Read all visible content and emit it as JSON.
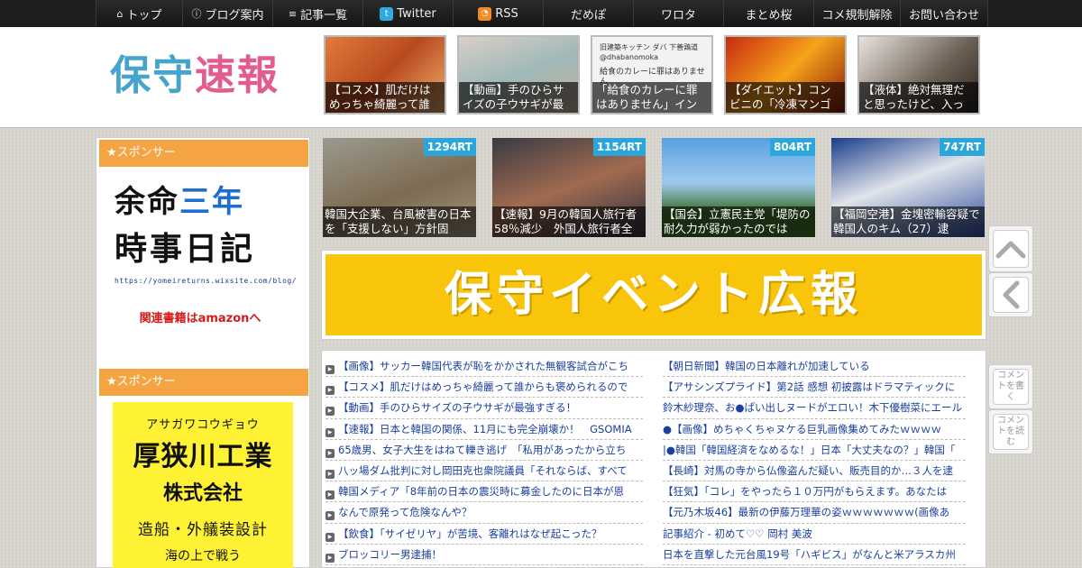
{
  "nav": {
    "items": [
      {
        "icon": "home-icon",
        "glyph": "⌂",
        "label": "トップ",
        "width": 96
      },
      {
        "icon": "info-icon",
        "glyph": "ⓘ",
        "label": "ブログ案内",
        "width": 100
      },
      {
        "icon": "list-icon",
        "glyph": "≡",
        "label": "記事一覧",
        "width": 100
      },
      {
        "icon": "twitter-icon",
        "glyph": "t",
        "label": "Twitter",
        "width": 100
      },
      {
        "icon": "rss-icon",
        "glyph": "◔",
        "label": "RSS",
        "width": 100
      },
      {
        "icon": "",
        "glyph": "",
        "label": "だめぽ",
        "width": 100
      },
      {
        "icon": "",
        "glyph": "",
        "label": "ワロタ",
        "width": 100
      },
      {
        "icon": "",
        "glyph": "",
        "label": "まとめ桜",
        "width": 100
      },
      {
        "icon": "",
        "glyph": "",
        "label": "コメ規制解除",
        "width": 96
      },
      {
        "icon": "",
        "glyph": "",
        "label": "お問い合わせ",
        "width": 98
      }
    ]
  },
  "header": {
    "logo_chars": [
      "保",
      "守",
      "速",
      "報"
    ]
  },
  "top_thumbs": [
    {
      "caption": "【コスメ】肌だけはめっちゃ綺麗って誰",
      "bg": "linear-gradient(135deg,#e07b3c,#b94a1e 50%,#f0b070)"
    },
    {
      "caption": "【動画】手のひらサイズの子ウサギが最",
      "bg": "linear-gradient(160deg,#d9cfc7,#9fb8b8 50%,#c9b49b)"
    },
    {
      "caption": "「給食のカレーに罪はありません」イン",
      "bg": "#f2f2f2",
      "tweet_name": "旧建築キッチン ダバ 下善鶏道",
      "tweet_handle": "@dhabanomoka",
      "tweet_text": "給食のカレーに罪はありません"
    },
    {
      "caption": "【ダイエット】コンビニの「冷凍マンゴ",
      "bg": "linear-gradient(135deg,#c62a12,#f5a31a 50%,#8a1a0a)"
    },
    {
      "caption": "【液体】絶対無理だと思ったけど、入っ",
      "bg": "linear-gradient(135deg,#e8e4de,#6a5e52 60%,#2a2420)"
    }
  ],
  "sidebar": {
    "sponsor_label": "★スポンサー",
    "ad1": {
      "line1_a": "余命",
      "line1_b": "三年",
      "line2": "時事日記",
      "url": "https://yomeireturns.wixsite.com/blog/",
      "amazon": "関連書籍はamazonへ"
    },
    "ad2": {
      "kana": "アサガワコウギョウ",
      "name": "厚狭川工業",
      "kk": "株式会社",
      "desc": "造船・外艤装設計",
      "cut": "海の上で戦う"
    }
  },
  "rt_thumbs": [
    {
      "rt": "1294RT",
      "caption": "韓国大企業、台風被害の日本を「支援しない」方針固",
      "bg": "linear-gradient(160deg,#9a9a8f,#7d6b52 55%,#a39580)"
    },
    {
      "rt": "1154RT",
      "caption": "【速報】9月の韓国人旅行者58％減少　外国人旅行者全",
      "bg": "linear-gradient(160deg,#3a3a44,#a06b50 50%,#2d3040)"
    },
    {
      "rt": "804RT",
      "caption": "【国会】立憲民主党「堤防の耐久力が弱かったのでは",
      "bg": "linear-gradient(180deg,#5aa0e0,#9fcaf0 45%,#3c6e2a 75%)"
    },
    {
      "rt": "747RT",
      "caption": "【福岡空港】金塊密輸容疑で韓国人のキム（27）逮",
      "bg": "linear-gradient(160deg,#1a3c8c,#e0e4ea 45%,#2a4a9a)"
    }
  ],
  "banner": {
    "text": "保守イベント広報"
  },
  "list_left": [
    "【画像】サッカー韓国代表が恥をかかされた無観客試合がこち",
    "【コスメ】肌だけはめっちゃ綺麗って誰からも褒められるので",
    "【動画】手のひらサイズの子ウサギが最強すぎる！",
    "【速報】日本と韓国の関係、11月にも完全崩壊か！　GSOMIA",
    "65歳男、女子大生をはねて轢き逃げ　「私用があったから立ち",
    "八ッ場ダム批判に対し岡田克也衆院議員「それならば、すべて",
    "韓国メディア「8年前の日本の震災時に募金したのに日本が恩",
    "なんで原発って危険なんや？",
    "【飲食】「サイゼリヤ」が苦境、客離れはなぜ起こった？",
    "ブロッコリー男逮捕！"
  ],
  "list_right": [
    "【朝日新聞】韓国の日本離れが加速している",
    "【アサシンズプライド】第2話 感想 初披露はドラマティックに",
    "鈴木紗理奈、お●ぱい出しヌードがエロい！木下優樹菜にエール",
    "●【画像】めちゃくちゃヌケる巨乳画像集めてみたｗｗｗｗ",
    "|●韓国「韓国経済をなめるな！」日本「大丈夫なの？」韓国「",
    "【長崎】対馬の寺から仏像盗んだ疑い、販売目的か…３人を逮",
    "【狂気】「コレ」をやったら１０万円がもらえます。あなたは",
    "【元乃木坂46】最新の伊藤万理華の姿ｗｗｗｗｗｗｗ(画像あ",
    "記事紹介 - 初めて♡♡ 岡村 美波",
    "日本を直撃した元台風19号「ハギビス」がなんと米アラスカ州"
  ],
  "float": {
    "up_label": "",
    "back_label": "",
    "write_comment": "コメントを書く",
    "read_comment": "コメントを読む"
  }
}
